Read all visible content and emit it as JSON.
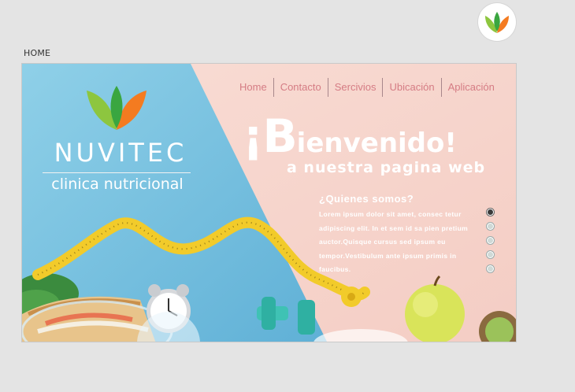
{
  "app": {
    "logo_icon": "leaf-logo-icon"
  },
  "page": {
    "label": "HOME"
  },
  "nav": {
    "items": [
      {
        "label": "Home"
      },
      {
        "label": "Contacto"
      },
      {
        "label": "Sercivios"
      },
      {
        "label": "Ubicación"
      },
      {
        "label": "Aplicación"
      }
    ]
  },
  "brand": {
    "name": "NUVITEC",
    "tagline": "clinica nutricional",
    "logo_icon": "leaf-logo-icon"
  },
  "hero": {
    "title_first": "¡B",
    "title_rest": "ienvenido!",
    "subtitle": "a nuestra pagina web"
  },
  "about": {
    "title": "¿Quienes somos?",
    "text": "Lorem ipsum dolor sit amet, consec tetur adipiscing elit. In et sem id sa pien pretium auctor.Quisque cursus sed ipsum eu tempor.Vestibulum ante ipsum primis in faucibus."
  },
  "slider": {
    "count": 5,
    "active": 1
  },
  "colors": {
    "background": "#e4e4e4",
    "blue_panel": "#7cc3df",
    "pink_panel": "#f7d8d0",
    "nav_text": "#d57c84",
    "leaf_green": "#8dc63f",
    "leaf_orange": "#f47b20"
  }
}
